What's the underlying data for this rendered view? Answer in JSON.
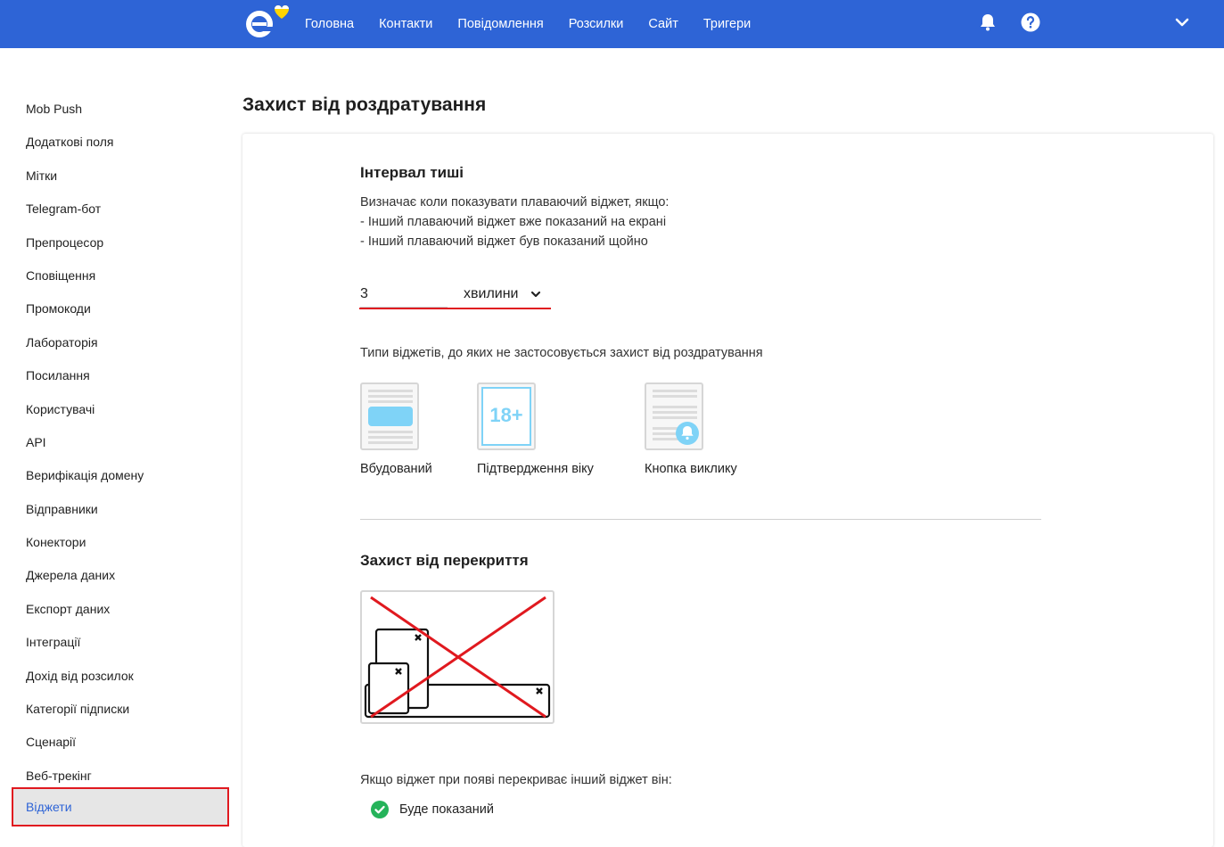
{
  "colors": {
    "topbar": "#2e64d6",
    "accent_red": "#e0191f",
    "active_link": "#2e64d6",
    "check_green": "#25b35a",
    "widget_blue": "#7fd3f7"
  },
  "nav": {
    "items": [
      "Головна",
      "Контакти",
      "Повідомлення",
      "Розсилки",
      "Сайт",
      "Тригери"
    ],
    "icons": [
      "bell-icon",
      "help-icon",
      "chevron-down-icon"
    ]
  },
  "sidebar": {
    "items": [
      "Mob Push",
      "Додаткові поля",
      "Мітки",
      "Telegram-бот",
      "Препроцесор",
      "Сповіщення",
      "Промокоди",
      "Лабораторія",
      "Посилання",
      "Користувачі",
      "API",
      "Верифікація домену",
      "Відправники",
      "Конектори",
      "Джерела даних",
      "Експорт даних",
      "Інтеграції",
      "Дохід від розсилок",
      "Категорії підписки",
      "Сценарії",
      "Веб-трекінг",
      "Віджети"
    ],
    "active_index": 21
  },
  "page": {
    "title": "Захист від роздратування"
  },
  "silence": {
    "title": "Інтервал тиші",
    "description": [
      "Визначає коли показувати плаваючий віджет, якщо:",
      "- Інший плаваючий віджет вже показаний на екрані",
      "- Інший плаваючий віджет був показаний щойно"
    ],
    "interval_value": "3",
    "unit": "хвилини",
    "excluded_title": "Типи віджетів, до яких не застосовується захист від роздратування",
    "widgets": [
      {
        "label": "Вбудований",
        "icon": "embedded-widget-icon"
      },
      {
        "label": "Підтвердження віку",
        "icon": "age-verification-icon",
        "badge": "18+"
      },
      {
        "label": "Кнопка виклику",
        "icon": "call-button-widget-icon"
      }
    ]
  },
  "overlap": {
    "title": "Захист від перекриття",
    "question": "Якщо віджет при появі перекриває інший віджет він:",
    "option": "Буде показаний"
  }
}
